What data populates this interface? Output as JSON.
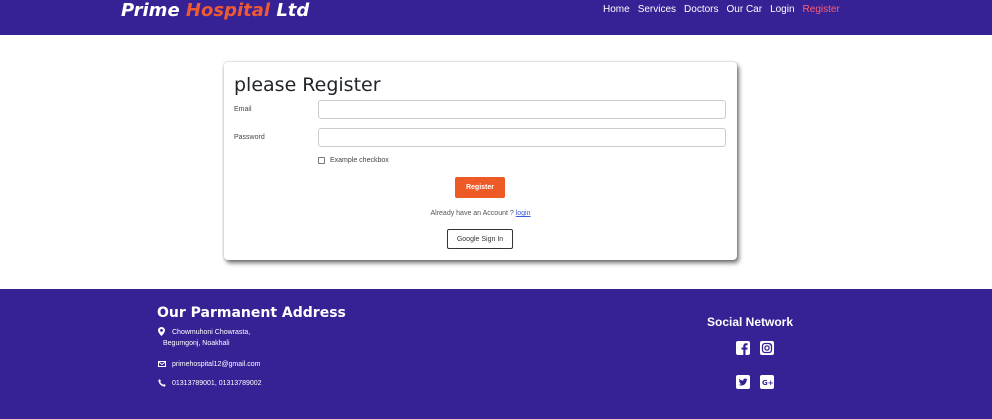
{
  "header": {
    "brand_part1": "Prime ",
    "brand_part2": "Hospital",
    "brand_part3": " Ltd",
    "nav": [
      {
        "label": "Home"
      },
      {
        "label": "Services"
      },
      {
        "label": "Doctors"
      },
      {
        "label": "Our Car"
      },
      {
        "label": "Login"
      },
      {
        "label": "Register"
      }
    ]
  },
  "form": {
    "title": "please Register",
    "email_label": "Email",
    "email_value": "",
    "password_label": "Password",
    "password_value": "",
    "checkbox_label": "Example checkbox",
    "register_label": "Register",
    "account_text": "Already have an Account ? ",
    "login_link": "login",
    "google_label": "Google Sign In"
  },
  "footer": {
    "address_title": "Our Parmanent Address",
    "address_line1": "Chowmuhoni Chowrasta,",
    "address_line2": "Begumgonj, Noakhali",
    "email": "primehospital12@gmail.com",
    "phone": "01313789001, 01313789002",
    "social_title": "Social Network",
    "icons": [
      "facebook-icon",
      "instagram-icon",
      "twitter-icon",
      "google-plus-icon"
    ]
  },
  "colors": {
    "brand_bg": "#362195",
    "accent": "#ee5a26",
    "nav_active": "#ff5f6e"
  }
}
